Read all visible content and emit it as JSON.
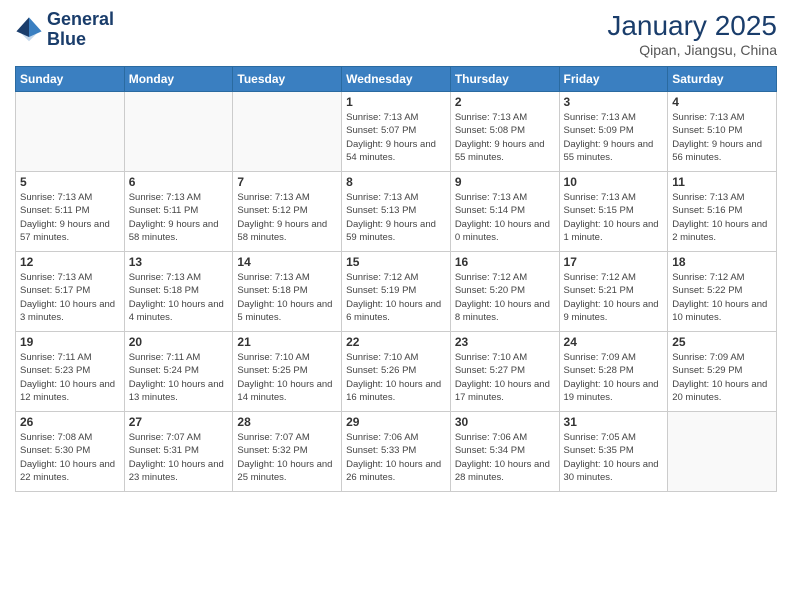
{
  "header": {
    "logo_line1": "General",
    "logo_line2": "Blue",
    "month_title": "January 2025",
    "location": "Qipan, Jiangsu, China"
  },
  "weekdays": [
    "Sunday",
    "Monday",
    "Tuesday",
    "Wednesday",
    "Thursday",
    "Friday",
    "Saturday"
  ],
  "weeks": [
    [
      {
        "day": "",
        "info": ""
      },
      {
        "day": "",
        "info": ""
      },
      {
        "day": "",
        "info": ""
      },
      {
        "day": "1",
        "info": "Sunrise: 7:13 AM\nSunset: 5:07 PM\nDaylight: 9 hours\nand 54 minutes."
      },
      {
        "day": "2",
        "info": "Sunrise: 7:13 AM\nSunset: 5:08 PM\nDaylight: 9 hours\nand 55 minutes."
      },
      {
        "day": "3",
        "info": "Sunrise: 7:13 AM\nSunset: 5:09 PM\nDaylight: 9 hours\nand 55 minutes."
      },
      {
        "day": "4",
        "info": "Sunrise: 7:13 AM\nSunset: 5:10 PM\nDaylight: 9 hours\nand 56 minutes."
      }
    ],
    [
      {
        "day": "5",
        "info": "Sunrise: 7:13 AM\nSunset: 5:11 PM\nDaylight: 9 hours\nand 57 minutes."
      },
      {
        "day": "6",
        "info": "Sunrise: 7:13 AM\nSunset: 5:11 PM\nDaylight: 9 hours\nand 58 minutes."
      },
      {
        "day": "7",
        "info": "Sunrise: 7:13 AM\nSunset: 5:12 PM\nDaylight: 9 hours\nand 58 minutes."
      },
      {
        "day": "8",
        "info": "Sunrise: 7:13 AM\nSunset: 5:13 PM\nDaylight: 9 hours\nand 59 minutes."
      },
      {
        "day": "9",
        "info": "Sunrise: 7:13 AM\nSunset: 5:14 PM\nDaylight: 10 hours\nand 0 minutes."
      },
      {
        "day": "10",
        "info": "Sunrise: 7:13 AM\nSunset: 5:15 PM\nDaylight: 10 hours\nand 1 minute."
      },
      {
        "day": "11",
        "info": "Sunrise: 7:13 AM\nSunset: 5:16 PM\nDaylight: 10 hours\nand 2 minutes."
      }
    ],
    [
      {
        "day": "12",
        "info": "Sunrise: 7:13 AM\nSunset: 5:17 PM\nDaylight: 10 hours\nand 3 minutes."
      },
      {
        "day": "13",
        "info": "Sunrise: 7:13 AM\nSunset: 5:18 PM\nDaylight: 10 hours\nand 4 minutes."
      },
      {
        "day": "14",
        "info": "Sunrise: 7:13 AM\nSunset: 5:18 PM\nDaylight: 10 hours\nand 5 minutes."
      },
      {
        "day": "15",
        "info": "Sunrise: 7:12 AM\nSunset: 5:19 PM\nDaylight: 10 hours\nand 6 minutes."
      },
      {
        "day": "16",
        "info": "Sunrise: 7:12 AM\nSunset: 5:20 PM\nDaylight: 10 hours\nand 8 minutes."
      },
      {
        "day": "17",
        "info": "Sunrise: 7:12 AM\nSunset: 5:21 PM\nDaylight: 10 hours\nand 9 minutes."
      },
      {
        "day": "18",
        "info": "Sunrise: 7:12 AM\nSunset: 5:22 PM\nDaylight: 10 hours\nand 10 minutes."
      }
    ],
    [
      {
        "day": "19",
        "info": "Sunrise: 7:11 AM\nSunset: 5:23 PM\nDaylight: 10 hours\nand 12 minutes."
      },
      {
        "day": "20",
        "info": "Sunrise: 7:11 AM\nSunset: 5:24 PM\nDaylight: 10 hours\nand 13 minutes."
      },
      {
        "day": "21",
        "info": "Sunrise: 7:10 AM\nSunset: 5:25 PM\nDaylight: 10 hours\nand 14 minutes."
      },
      {
        "day": "22",
        "info": "Sunrise: 7:10 AM\nSunset: 5:26 PM\nDaylight: 10 hours\nand 16 minutes."
      },
      {
        "day": "23",
        "info": "Sunrise: 7:10 AM\nSunset: 5:27 PM\nDaylight: 10 hours\nand 17 minutes."
      },
      {
        "day": "24",
        "info": "Sunrise: 7:09 AM\nSunset: 5:28 PM\nDaylight: 10 hours\nand 19 minutes."
      },
      {
        "day": "25",
        "info": "Sunrise: 7:09 AM\nSunset: 5:29 PM\nDaylight: 10 hours\nand 20 minutes."
      }
    ],
    [
      {
        "day": "26",
        "info": "Sunrise: 7:08 AM\nSunset: 5:30 PM\nDaylight: 10 hours\nand 22 minutes."
      },
      {
        "day": "27",
        "info": "Sunrise: 7:07 AM\nSunset: 5:31 PM\nDaylight: 10 hours\nand 23 minutes."
      },
      {
        "day": "28",
        "info": "Sunrise: 7:07 AM\nSunset: 5:32 PM\nDaylight: 10 hours\nand 25 minutes."
      },
      {
        "day": "29",
        "info": "Sunrise: 7:06 AM\nSunset: 5:33 PM\nDaylight: 10 hours\nand 26 minutes."
      },
      {
        "day": "30",
        "info": "Sunrise: 7:06 AM\nSunset: 5:34 PM\nDaylight: 10 hours\nand 28 minutes."
      },
      {
        "day": "31",
        "info": "Sunrise: 7:05 AM\nSunset: 5:35 PM\nDaylight: 10 hours\nand 30 minutes."
      },
      {
        "day": "",
        "info": ""
      }
    ]
  ]
}
